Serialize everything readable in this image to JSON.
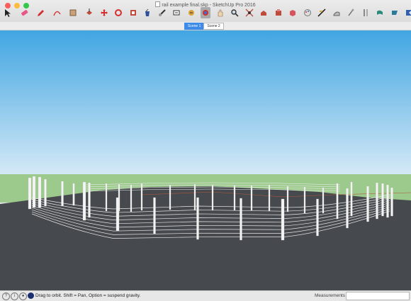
{
  "window": {
    "title": "rail example final.skp - SketchUp Pro 2016",
    "lights": [
      "#fc605c",
      "#fdbc40",
      "#34c84a"
    ]
  },
  "toolbar": {
    "tools": [
      {
        "name": "select-tool",
        "icon": "arrow"
      },
      {
        "name": "eraser-tool",
        "icon": "eraser"
      },
      {
        "name": "line-tool",
        "icon": "pencil"
      },
      {
        "name": "arc-tool",
        "icon": "arc"
      },
      {
        "name": "rectangle-tool",
        "icon": "rectangle"
      },
      {
        "name": "push-pull-tool",
        "icon": "pushpull"
      },
      {
        "name": "move-tool",
        "icon": "move"
      },
      {
        "name": "rotate-tool",
        "icon": "rotate"
      },
      {
        "name": "offset-tool",
        "icon": "offset"
      },
      {
        "name": "paint-bucket-tool",
        "icon": "bucket"
      },
      {
        "name": "tape-measure-tool",
        "icon": "tape"
      },
      {
        "name": "text-tool",
        "icon": "text"
      },
      {
        "name": "follow-me-tool",
        "icon": "followme"
      },
      {
        "name": "orbit-tool",
        "icon": "orbit",
        "active": true
      },
      {
        "name": "pan-tool",
        "icon": "hand"
      },
      {
        "name": "zoom-tool",
        "icon": "magnifier"
      },
      {
        "name": "zoom-extents-tool",
        "icon": "zoomextents"
      },
      {
        "name": "warehouse-tool",
        "icon": "warehouse"
      },
      {
        "name": "extension-warehouse-tool",
        "icon": "extension"
      },
      {
        "name": "component-tool",
        "icon": "component"
      },
      {
        "name": "styles-tool",
        "icon": "styles"
      },
      {
        "name": "section-tool",
        "icon": "section"
      },
      {
        "name": "sandbox-tool",
        "icon": "sandbox"
      },
      {
        "name": "dimension-tool",
        "icon": "dimension"
      },
      {
        "name": "look-around-tool",
        "icon": "eye"
      },
      {
        "name": "walk-tool",
        "icon": "walk"
      },
      {
        "name": "position-camera-tool",
        "icon": "camera"
      },
      {
        "name": "layout-tool",
        "icon": "layout"
      }
    ]
  },
  "scenes": {
    "tabs": [
      {
        "label": "Scene 1",
        "active": true
      },
      {
        "label": "Scene 2",
        "active": false
      }
    ]
  },
  "viewport": {
    "sky_top": "#41a6e2",
    "sky_bottom": "#d5e9f6",
    "grass": "#9cc98c",
    "ground": "#46494d"
  },
  "statusbar": {
    "hint": "Drag to orbit. Shift = Pan, Option = suspend gravity.",
    "measurements_label": "Measurements",
    "measurements_value": ""
  }
}
